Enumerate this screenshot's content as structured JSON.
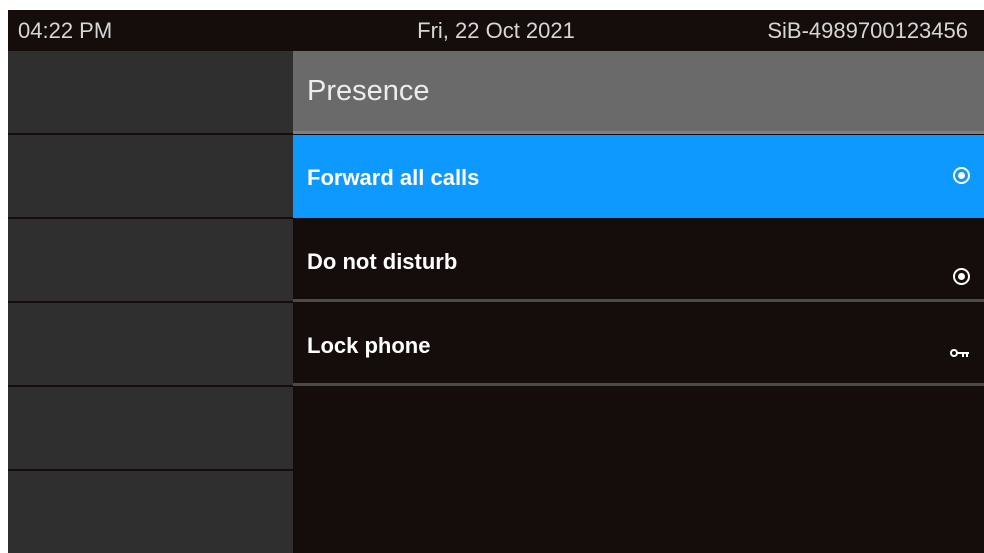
{
  "status_bar": {
    "time": "04:22 PM",
    "date": "Fri, 22 Oct 2021",
    "number": "SiB-4989700123456"
  },
  "left_keys": [
    "",
    "",
    "",
    "",
    "",
    ""
  ],
  "panel": {
    "title": "Presence",
    "items": [
      {
        "label": "Forward all calls",
        "icon": "radio-icon",
        "selected": true
      },
      {
        "label": "Do not disturb",
        "icon": "radio-icon",
        "selected": false
      },
      {
        "label": "Lock phone",
        "icon": "key-icon",
        "selected": false
      }
    ]
  },
  "colors": {
    "background": "#150c0c",
    "header": "#6a6a6a",
    "selected": "#0d99ff",
    "left_key": "#2f2f2f"
  }
}
